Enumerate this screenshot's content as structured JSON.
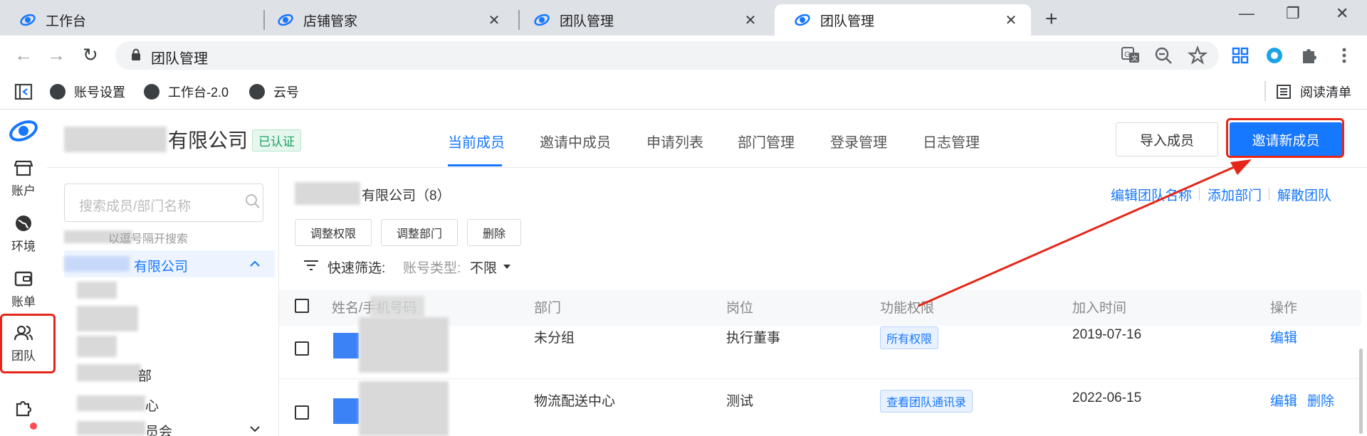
{
  "browser": {
    "tabs": [
      {
        "label": "工作台",
        "active": false
      },
      {
        "label": "店铺管家",
        "active": false
      },
      {
        "label": "团队管理",
        "active": false
      },
      {
        "label": "团队管理",
        "active": true
      }
    ],
    "url": "团队管理",
    "bookmarks": [
      "账号设置",
      "工作台-2.0",
      "云号"
    ],
    "reading_list": "阅读清单"
  },
  "rail": {
    "items": [
      {
        "label": "账户",
        "icon": "shop-icon"
      },
      {
        "label": "环境",
        "icon": "globe-icon"
      },
      {
        "label": "账单",
        "icon": "wallet-icon"
      },
      {
        "label": "团队",
        "icon": "team-icon"
      }
    ]
  },
  "header": {
    "company_suffix": "有限公司",
    "verified": "已认证",
    "nav": [
      "当前成员",
      "邀请中成员",
      "申请列表",
      "部门管理",
      "登录管理",
      "日志管理"
    ],
    "import_button": "导入成员",
    "invite_button": "邀请新成员"
  },
  "sidebar": {
    "search_placeholder": "搜索成员/部门名称",
    "tip": "以逗号隔开搜索",
    "selected": "有限公司",
    "tree": [
      "部",
      "心",
      "员会"
    ]
  },
  "main": {
    "crumb": "有限公司（8）",
    "links": [
      "编辑团队名称",
      "添加部门",
      "解散团队"
    ],
    "buttons": [
      "调整权限",
      "调整部门",
      "删除"
    ],
    "filter_label": "快速筛选:",
    "filter_field": "账号类型:",
    "filter_value": "不限"
  },
  "table": {
    "headers": [
      "姓名/手机号码",
      "部门",
      "岗位",
      "功能权限",
      "加入时间",
      "操作"
    ],
    "rows": [
      {
        "dept": "未分组",
        "post": "执行董事",
        "perm": "所有权限",
        "date": "2019-07-16",
        "ops": [
          "编辑"
        ]
      },
      {
        "dept": "物流配送中心",
        "post": "测试",
        "perm": "查看团队通讯录",
        "date": "2022-06-15",
        "ops": [
          "编辑",
          "删除"
        ]
      }
    ]
  },
  "colors": {
    "accent": "#1677ff",
    "highlight": "#e5261a",
    "verified": "#19a15f"
  }
}
